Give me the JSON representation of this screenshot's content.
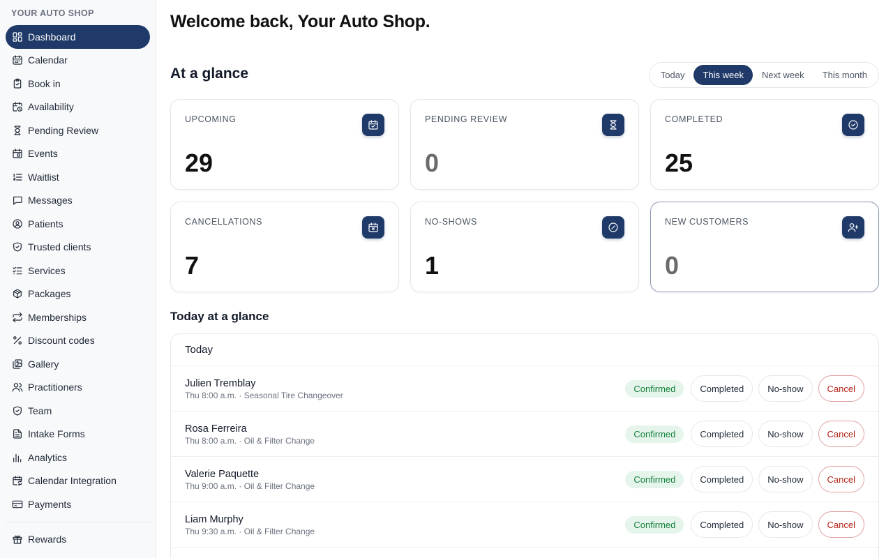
{
  "sidebar": {
    "brand": "YOUR AUTO SHOP",
    "items": [
      {
        "label": "Dashboard",
        "icon": "dashboard-icon",
        "active": true
      },
      {
        "label": "Calendar",
        "icon": "calendar-icon"
      },
      {
        "label": "Book in",
        "icon": "clipboard-icon"
      },
      {
        "label": "Availability",
        "icon": "calendar-clock-icon"
      },
      {
        "label": "Pending Review",
        "icon": "hourglass-icon"
      },
      {
        "label": "Events",
        "icon": "calendar-event-icon"
      },
      {
        "label": "Waitlist",
        "icon": "list-ordered-icon"
      },
      {
        "label": "Messages",
        "icon": "message-icon"
      },
      {
        "label": "Patients",
        "icon": "user-circle-icon"
      },
      {
        "label": "Trusted clients",
        "icon": "shield-check-icon"
      },
      {
        "label": "Services",
        "icon": "list-checks-icon"
      },
      {
        "label": "Packages",
        "icon": "package-icon"
      },
      {
        "label": "Memberships",
        "icon": "repeat-icon"
      },
      {
        "label": "Discount codes",
        "icon": "percent-icon"
      },
      {
        "label": "Gallery",
        "icon": "image-icon"
      },
      {
        "label": "Practitioners",
        "icon": "users-icon"
      },
      {
        "label": "Team",
        "icon": "shield-icon"
      },
      {
        "label": "Intake Forms",
        "icon": "file-text-icon"
      },
      {
        "label": "Analytics",
        "icon": "bar-chart-icon"
      },
      {
        "label": "Calendar Integration",
        "icon": "calendar-sync-icon"
      },
      {
        "label": "Payments",
        "icon": "credit-card-icon"
      }
    ],
    "bottom_items": [
      {
        "label": "Rewards",
        "icon": "gift-icon"
      }
    ]
  },
  "main": {
    "welcome": "Welcome back, Your Auto Shop.",
    "glance_title": "At a glance",
    "ranges": [
      {
        "label": "Today",
        "active": false
      },
      {
        "label": "This week",
        "active": true
      },
      {
        "label": "Next week",
        "active": false
      },
      {
        "label": "This month",
        "active": false
      }
    ],
    "cards": [
      {
        "label": "UPCOMING",
        "value": "29",
        "icon": "calendar-check-icon",
        "muted": false
      },
      {
        "label": "PENDING REVIEW",
        "value": "0",
        "icon": "hourglass-icon",
        "muted": true
      },
      {
        "label": "COMPLETED",
        "value": "25",
        "icon": "check-circle-icon",
        "muted": false
      },
      {
        "label": "CANCELLATIONS",
        "value": "7",
        "icon": "calendar-x-icon",
        "muted": false
      },
      {
        "label": "NO-SHOWS",
        "value": "1",
        "icon": "ban-icon",
        "muted": false
      },
      {
        "label": "NEW CUSTOMERS",
        "value": "0",
        "icon": "user-plus-icon",
        "muted": true
      }
    ],
    "today_title": "Today at a glance",
    "today_header": "Today",
    "appointments": [
      {
        "name": "Julien Tremblay",
        "meta": "Thu 8:00 a.m. · Seasonal Tire Changeover",
        "status": "Confirmed"
      },
      {
        "name": "Rosa Ferreira",
        "meta": "Thu 8:00 a.m. · Oil & Filter Change",
        "status": "Confirmed"
      },
      {
        "name": "Valerie Paquette",
        "meta": "Thu 9:00 a.m. · Oil & Filter Change",
        "status": "Confirmed"
      },
      {
        "name": "Liam Murphy",
        "meta": "Thu 9:30 a.m. · Oil & Filter Change",
        "status": "Confirmed"
      }
    ],
    "actions": {
      "completed": "Completed",
      "no_show": "No-show",
      "cancel": "Cancel"
    }
  },
  "colors": {
    "accent": "#1f3a68",
    "confirmed_bg": "#e5f5ec",
    "confirmed_text": "#16803c",
    "cancel_text": "#b42318"
  }
}
